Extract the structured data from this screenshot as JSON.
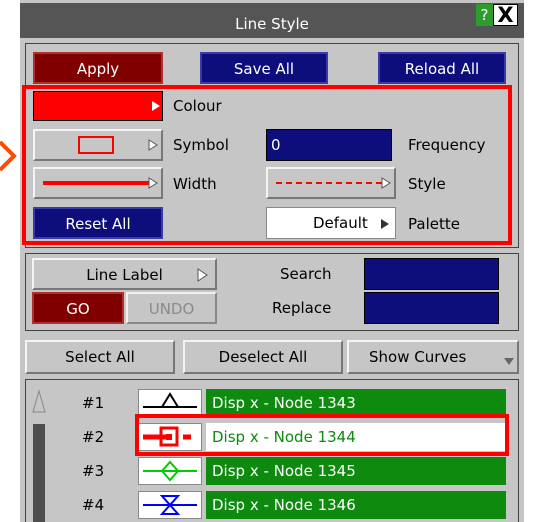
{
  "window": {
    "title": "Line Style",
    "help_label": "?",
    "close_label": "X"
  },
  "toolbar": {
    "apply": "Apply",
    "save_all": "Save All",
    "reload_all": "Reload All"
  },
  "style_panel": {
    "colour_label": "Colour",
    "colour_value": "#ff0000",
    "symbol_label": "Symbol",
    "frequency_label": "Frequency",
    "frequency_value": "0",
    "width_label": "Width",
    "style_label": "Style",
    "reset_all": "Reset All",
    "palette_value": "Default",
    "palette_label": "Palette"
  },
  "label_panel": {
    "line_label": "Line Label",
    "go": "GO",
    "undo": "UNDO",
    "search_label": "Search",
    "search_value": "",
    "replace_label": "Replace",
    "replace_value": ""
  },
  "actions": {
    "select_all": "Select All",
    "deselect_all": "Deselect All",
    "show_curves": "Show Curves"
  },
  "curves": [
    {
      "num": "#1",
      "name": "Disp x - Node 1343",
      "color": "#000000",
      "selected": false
    },
    {
      "num": "#2",
      "name": "Disp x - Node 1344",
      "color": "#ff0000",
      "selected": true
    },
    {
      "num": "#3",
      "name": "Disp x - Node 1345",
      "color": "#00cc00",
      "selected": false
    },
    {
      "num": "#4",
      "name": "Disp x - Node 1346",
      "color": "#0000ff",
      "selected": false
    }
  ],
  "colors": {
    "panel_bg": "#c6c6c6",
    "title_bg": "#555555",
    "apply_red": "#800000",
    "navy": "#0d0d7c",
    "list_green": "#0e8a0e",
    "highlight_red": "#ff0000",
    "callout_orange": "#ff4a00"
  }
}
